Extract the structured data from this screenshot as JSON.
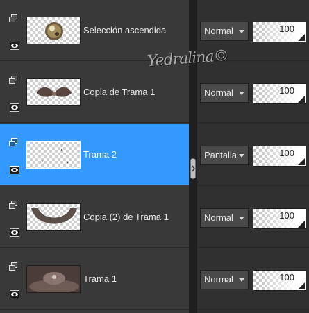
{
  "layers": [
    {
      "name": "Selección ascendida",
      "blend_mode": "Normal",
      "opacity": "100",
      "selected": false,
      "thumb": "orb"
    },
    {
      "name": "Copia de Trama 1",
      "blend_mode": "Normal",
      "opacity": "100",
      "selected": false,
      "thumb": "wings"
    },
    {
      "name": "Trama 2",
      "blend_mode": "Pantalla",
      "opacity": "100",
      "selected": true,
      "thumb": "sparkles"
    },
    {
      "name": "Copia (2) de Trama 1",
      "blend_mode": "Normal",
      "opacity": "100",
      "selected": false,
      "thumb": "arc"
    },
    {
      "name": "Trama 1",
      "blend_mode": "Normal",
      "opacity": "100",
      "selected": false,
      "thumb": "background"
    }
  ],
  "watermark": "Yedralina©",
  "colors": {
    "selected": "#3399ff",
    "panel": "#393939",
    "text": "#e6e6e6"
  },
  "icons": {
    "layer_type": "raster-layer-icon",
    "visibility": "eye-icon",
    "dropdown": "chevron-down-icon"
  }
}
